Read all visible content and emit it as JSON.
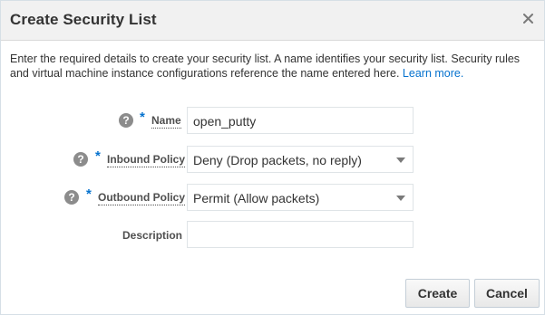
{
  "dialog": {
    "title": "Create Security List",
    "close_icon": "close-icon",
    "intro_text": "Enter the required details to create your security list. A name identifies your security list. Security rules and virtual machine instance configurations reference the name entered here.",
    "learn_more": "Learn more."
  },
  "form": {
    "help_glyph": "?",
    "required_mark": "*",
    "name": {
      "label": "Name",
      "value": "open_putty"
    },
    "inbound_policy": {
      "label": "Inbound Policy",
      "selected": "Deny (Drop packets, no reply)"
    },
    "outbound_policy": {
      "label": "Outbound Policy",
      "selected": "Permit (Allow packets)"
    },
    "description": {
      "label": "Description",
      "value": ""
    }
  },
  "buttons": {
    "create": "Create",
    "cancel": "Cancel"
  },
  "colors": {
    "accent": "#0572ce",
    "header_bg": "#f1f1f1",
    "help_icon": "#8c8c8c"
  }
}
